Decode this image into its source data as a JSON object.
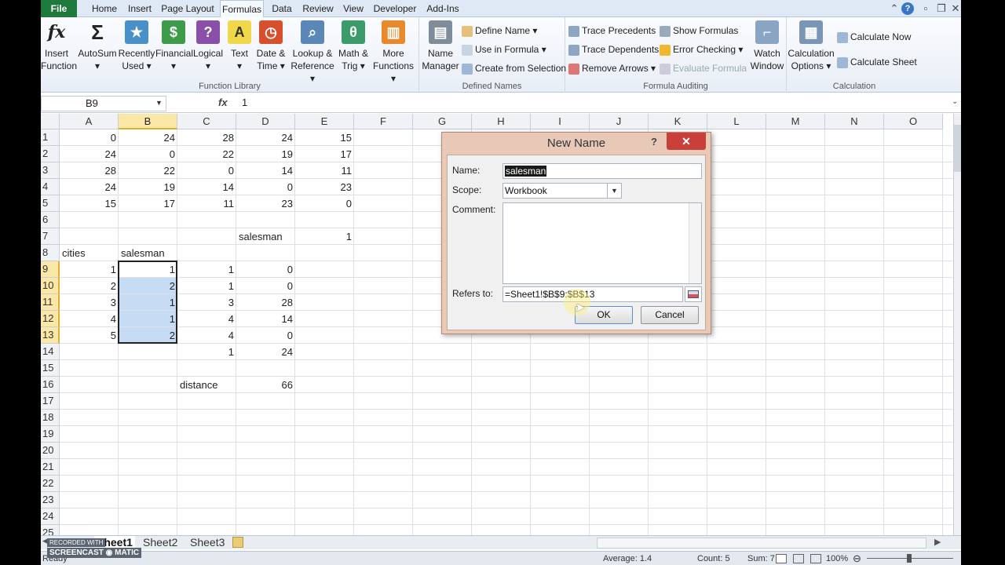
{
  "tabs": [
    "File",
    "Home",
    "Insert",
    "Page Layout",
    "Formulas",
    "Data",
    "Review",
    "View",
    "Developer",
    "Add-Ins"
  ],
  "ribbon": {
    "function_library": {
      "label": "Function Library",
      "buttons": [
        {
          "line1": "Insert",
          "line2": "Function"
        },
        {
          "line1": "AutoSum",
          "line2": "▾"
        },
        {
          "line1": "Recently",
          "line2": "Used ▾"
        },
        {
          "line1": "Financial",
          "line2": "▾"
        },
        {
          "line1": "Logical",
          "line2": "▾"
        },
        {
          "line1": "Text",
          "line2": "▾"
        },
        {
          "line1": "Date &",
          "line2": "Time ▾"
        },
        {
          "line1": "Lookup &",
          "line2": "Reference ▾"
        },
        {
          "line1": "Math &",
          "line2": "Trig ▾"
        },
        {
          "line1": "More",
          "line2": "Functions ▾"
        }
      ]
    },
    "defined_names": {
      "label": "Defined Names",
      "name_manager": {
        "line1": "Name",
        "line2": "Manager"
      },
      "define_name": "Define Name ▾",
      "use_in_formula": "Use in Formula ▾",
      "create_from_selection": "Create from Selection"
    },
    "formula_auditing": {
      "label": "Formula Auditing",
      "trace_precedents": "Trace Precedents",
      "trace_dependents": "Trace Dependents",
      "remove_arrows": "Remove Arrows ▾",
      "show_formulas": "Show Formulas",
      "error_checking": "Error Checking ▾",
      "evaluate_formula": "Evaluate Formula",
      "watch_window": {
        "line1": "Watch",
        "line2": "Window"
      }
    },
    "calculation": {
      "label": "Calculation",
      "options": {
        "line1": "Calculation",
        "line2": "Options ▾"
      },
      "calculate_now": "Calculate Now",
      "calculate_sheet": "Calculate Sheet"
    }
  },
  "formula_bar": {
    "name_box": "B9",
    "fx": "fx",
    "value": "1"
  },
  "columns": [
    "A",
    "B",
    "C",
    "D",
    "E",
    "F",
    "G",
    "H",
    "I",
    "J",
    "K",
    "L",
    "M",
    "N",
    "O"
  ],
  "rows": [
    "1",
    "2",
    "3",
    "4",
    "5",
    "6",
    "7",
    "8",
    "9",
    "10",
    "11",
    "12",
    "13",
    "14",
    "15",
    "16",
    "17",
    "18",
    "19",
    "20",
    "21",
    "22",
    "23",
    "24",
    "25"
  ],
  "cells": {
    "A1": "0",
    "B1": "24",
    "C1": "28",
    "D1": "24",
    "E1": "15",
    "A2": "24",
    "B2": "0",
    "C2": "22",
    "D2": "19",
    "E2": "17",
    "A3": "28",
    "B3": "22",
    "C3": "0",
    "D3": "14",
    "E3": "11",
    "A4": "24",
    "B4": "19",
    "C4": "14",
    "D4": "0",
    "E4": "23",
    "A5": "15",
    "B5": "17",
    "C5": "11",
    "D5": "23",
    "E5": "0",
    "D7": "salesman",
    "E7": "1",
    "A8": "cities",
    "B8": "salesman",
    "A9": "1",
    "B9": "1",
    "C9": "1",
    "D9": "0",
    "A10": "2",
    "B10": "2",
    "C10": "1",
    "D10": "0",
    "A11": "3",
    "B11": "1",
    "C11": "3",
    "D11": "28",
    "A12": "4",
    "B12": "1",
    "C12": "4",
    "D12": "14",
    "A13": "5",
    "B13": "2",
    "C13": "4",
    "D13": "0",
    "C14": "1",
    "D14": "24",
    "C16": "distance",
    "D16": "66"
  },
  "sheets": [
    "Sheet1",
    "Sheet2",
    "Sheet3"
  ],
  "status": {
    "ready": "Ready",
    "average": "Average: 1.4",
    "count": "Count: 5",
    "sum": "Sum: 7",
    "zoom": "100%"
  },
  "dialog": {
    "title": "New Name",
    "help": "?",
    "close": "✕",
    "name_label": "Name:",
    "name_value": "salesman",
    "scope_label": "Scope:",
    "scope_value": "Workbook",
    "comment_label": "Comment:",
    "refers_label": "Refers to:",
    "refers_value": "=Sheet1!$B$9:$B$13",
    "ok": "OK",
    "cancel": "Cancel"
  },
  "colors": {
    "file_tab": "#1e7a3c",
    "selection": "#c6dcf5",
    "header_selected": "#fbe8a6",
    "close_button": "#c9403a"
  }
}
